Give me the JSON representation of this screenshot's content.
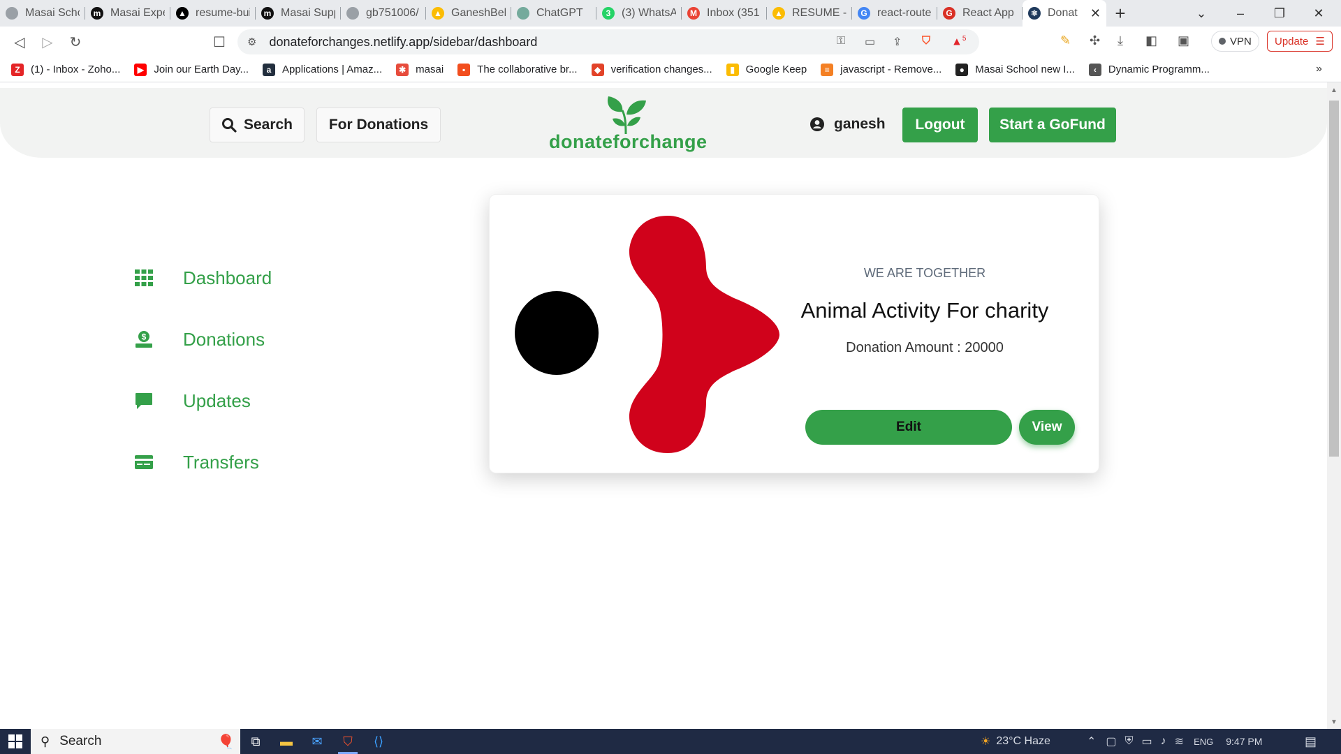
{
  "browser": {
    "tabs": [
      {
        "label": "Masai Scho",
        "fav": "#9aa0a6",
        "glyph": ""
      },
      {
        "label": "Masai Expe",
        "fav": "#111111",
        "glyph": "m"
      },
      {
        "label": "resume-bui",
        "fav": "#000000",
        "glyph": "▲"
      },
      {
        "label": "Masai Supp",
        "fav": "#111111",
        "glyph": "m"
      },
      {
        "label": "gb751006/",
        "fav": "#9aa0a6",
        "glyph": ""
      },
      {
        "label": "GaneshBeh",
        "fav": "#fbbc04",
        "glyph": "▲"
      },
      {
        "label": "ChatGPT",
        "fav": "#74aa9c",
        "glyph": ""
      },
      {
        "label": "(3) WhatsA",
        "fav": "#25d366",
        "glyph": "3"
      },
      {
        "label": "Inbox (351",
        "fav": "#ea4335",
        "glyph": "M"
      },
      {
        "label": "RESUME - (",
        "fav": "#fbbc04",
        "glyph": "▲"
      },
      {
        "label": "react-route",
        "fav": "#4285f4",
        "glyph": "G"
      },
      {
        "label": "React App",
        "fav": "#d93025",
        "glyph": "G"
      }
    ],
    "active_tab": {
      "label": "Donat",
      "close": "✕"
    },
    "new_tab": "+",
    "url": "donateforchanges.netlify.app/sidebar/dashboard",
    "vpn_label": "VPN",
    "update_label": "Update",
    "brave_badge": "5",
    "bookmarks": [
      {
        "label": "(1) - Inbox - Zoho...",
        "color": "#e42527",
        "glyph": "Z"
      },
      {
        "label": "Join our Earth Day...",
        "color": "#ff0000",
        "glyph": "▶"
      },
      {
        "label": "Applications | Amaz...",
        "color": "#232f3e",
        "glyph": "a"
      },
      {
        "label": "masai",
        "color": "#e74c3c",
        "glyph": "✱"
      },
      {
        "label": "The collaborative br...",
        "color": "#f24e1e",
        "glyph": "▪"
      },
      {
        "label": "verification changes...",
        "color": "#e24329",
        "glyph": "◆"
      },
      {
        "label": "Google Keep",
        "color": "#fbbc04",
        "glyph": "▮"
      },
      {
        "label": "javascript - Remove...",
        "color": "#f48024",
        "glyph": "≡"
      },
      {
        "label": "Masai School new I...",
        "color": "#222222",
        "glyph": "●"
      },
      {
        "label": "Dynamic Programm...",
        "color": "#555555",
        "glyph": "‹"
      }
    ]
  },
  "header": {
    "search_label": "Search",
    "donations_label": "For Donations",
    "logo_text": "donateforchange",
    "username": "ganesh",
    "logout_label": "Logout",
    "gofund_label": "Start a GoFund"
  },
  "sidebar": {
    "items": [
      {
        "label": "Dashboard",
        "icon": "grid-icon"
      },
      {
        "label": "Donations",
        "icon": "donate-icon"
      },
      {
        "label": "Updates",
        "icon": "chat-icon"
      },
      {
        "label": "Transfers",
        "icon": "card-icon"
      }
    ]
  },
  "card": {
    "kicker": "WE ARE TOGETHER",
    "title": "Animal Activity For charity",
    "amount": "Donation Amount : 20000",
    "edit_label": "Edit",
    "view_label": "View"
  },
  "taskbar": {
    "search_label": "Search",
    "weather": "23°C  Haze",
    "lang": "ENG",
    "time": "9:47 PM"
  },
  "colors": {
    "brand_green": "#34a049",
    "art_red": "#d0021b"
  }
}
